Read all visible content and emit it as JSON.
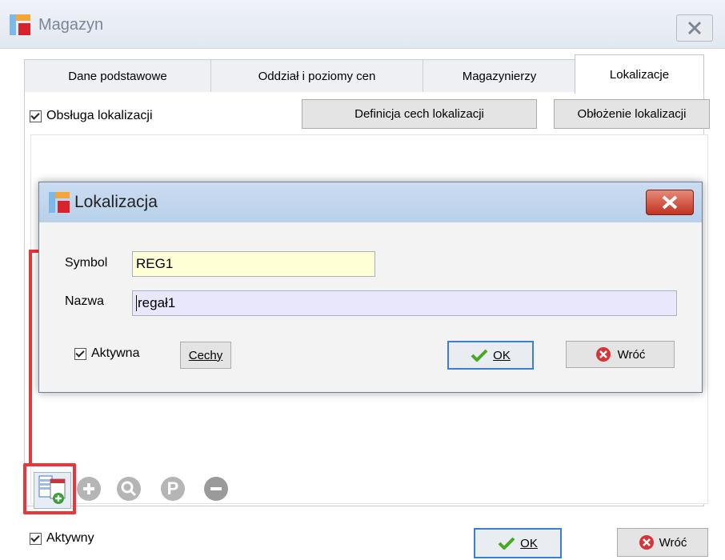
{
  "window": {
    "title": "Magazyn"
  },
  "tabs": [
    {
      "label": "Dane podstawowe"
    },
    {
      "label": "Oddział i poziomy cen"
    },
    {
      "label": "Magazynierzy"
    },
    {
      "label": "Lokalizacje"
    }
  ],
  "location_panel": {
    "handling_checkbox": "Obsługa lokalizacji",
    "features_def_button": "Definicja cech lokalizacji",
    "occupancy_button": "Obłożenie lokalizacji"
  },
  "dialog": {
    "title": "Lokalizacja",
    "symbol_label": "Symbol",
    "symbol_value": "REG1",
    "name_label": "Nazwa",
    "name_value": "regał1",
    "active_checkbox": "Aktywna",
    "features_button": "Cechy",
    "ok_button": "OK",
    "back_button": "Wróć"
  },
  "toolbar": {
    "p_icon_text": "P"
  },
  "footer": {
    "active_checkbox": "Aktywny",
    "ok_button": "OK",
    "back_button": "Wróć"
  },
  "colors": {
    "symbol_field_bg": "#ffffd6",
    "name_field_bg": "#e9e7fb",
    "annotation_red": "#e8363a",
    "ok_check_green": "#4aa824",
    "back_icon_red": "#d6343a"
  }
}
